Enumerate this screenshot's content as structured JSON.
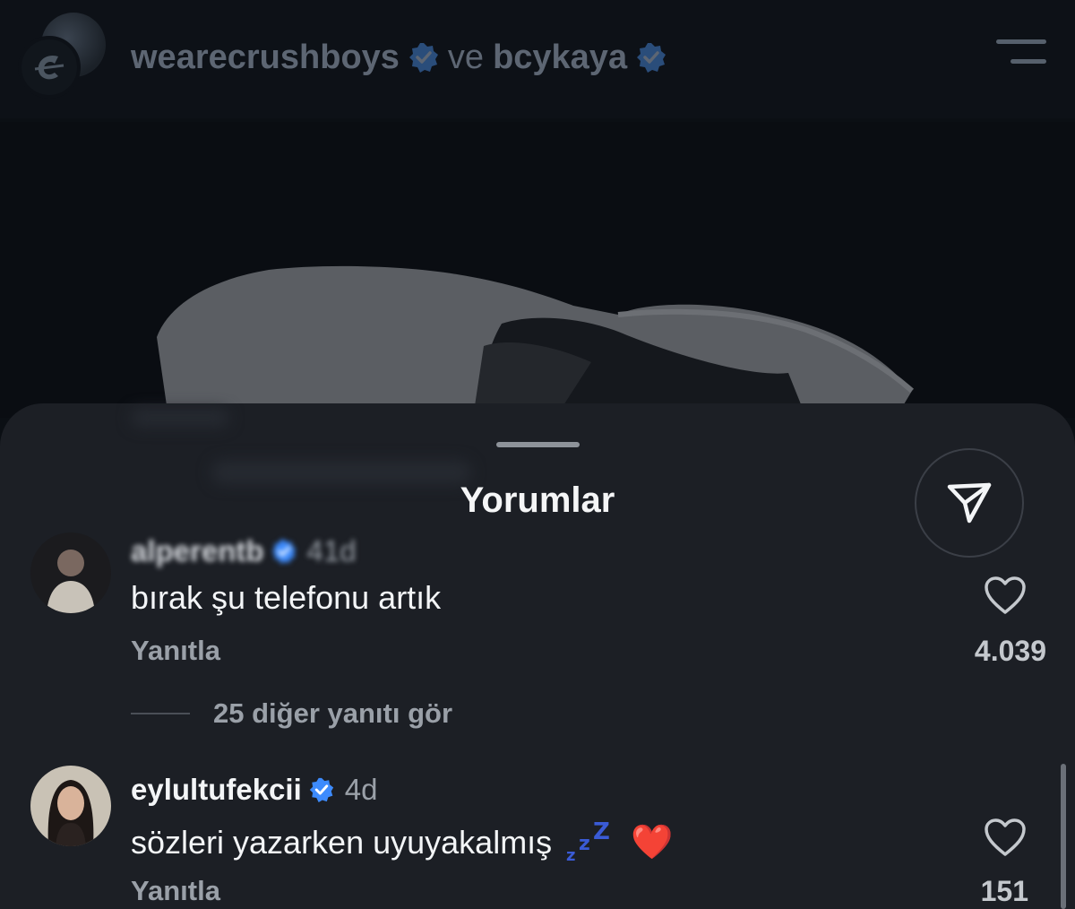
{
  "header": {
    "user1": "wearecrushboys",
    "conjunction": "ve",
    "user2": "bcykaya"
  },
  "sheet": {
    "title": "Yorumlar"
  },
  "comments": [
    {
      "username": "alperentb",
      "time": "41d",
      "text": "bırak şu telefonu artık",
      "reply_label": "Yanıtla",
      "like_count": "4.039",
      "more_replies": "25 diğer yanıtı gör"
    },
    {
      "username": "eylultufekcii",
      "time": "4d",
      "text": "sözleri yazarken uyuyakalmış",
      "emoji_heart": "❤️",
      "reply_label": "Yanıtla",
      "like_count": "151"
    }
  ],
  "colors": {
    "accent_verified": "#3d8bfd",
    "sheet_bg": "#1c1f25",
    "heart_red": "#e0245e"
  },
  "icons": [
    "verified-badge-icon",
    "menu-icon",
    "share-send-icon",
    "heart-outline-icon",
    "sleep-zzz-icon"
  ]
}
